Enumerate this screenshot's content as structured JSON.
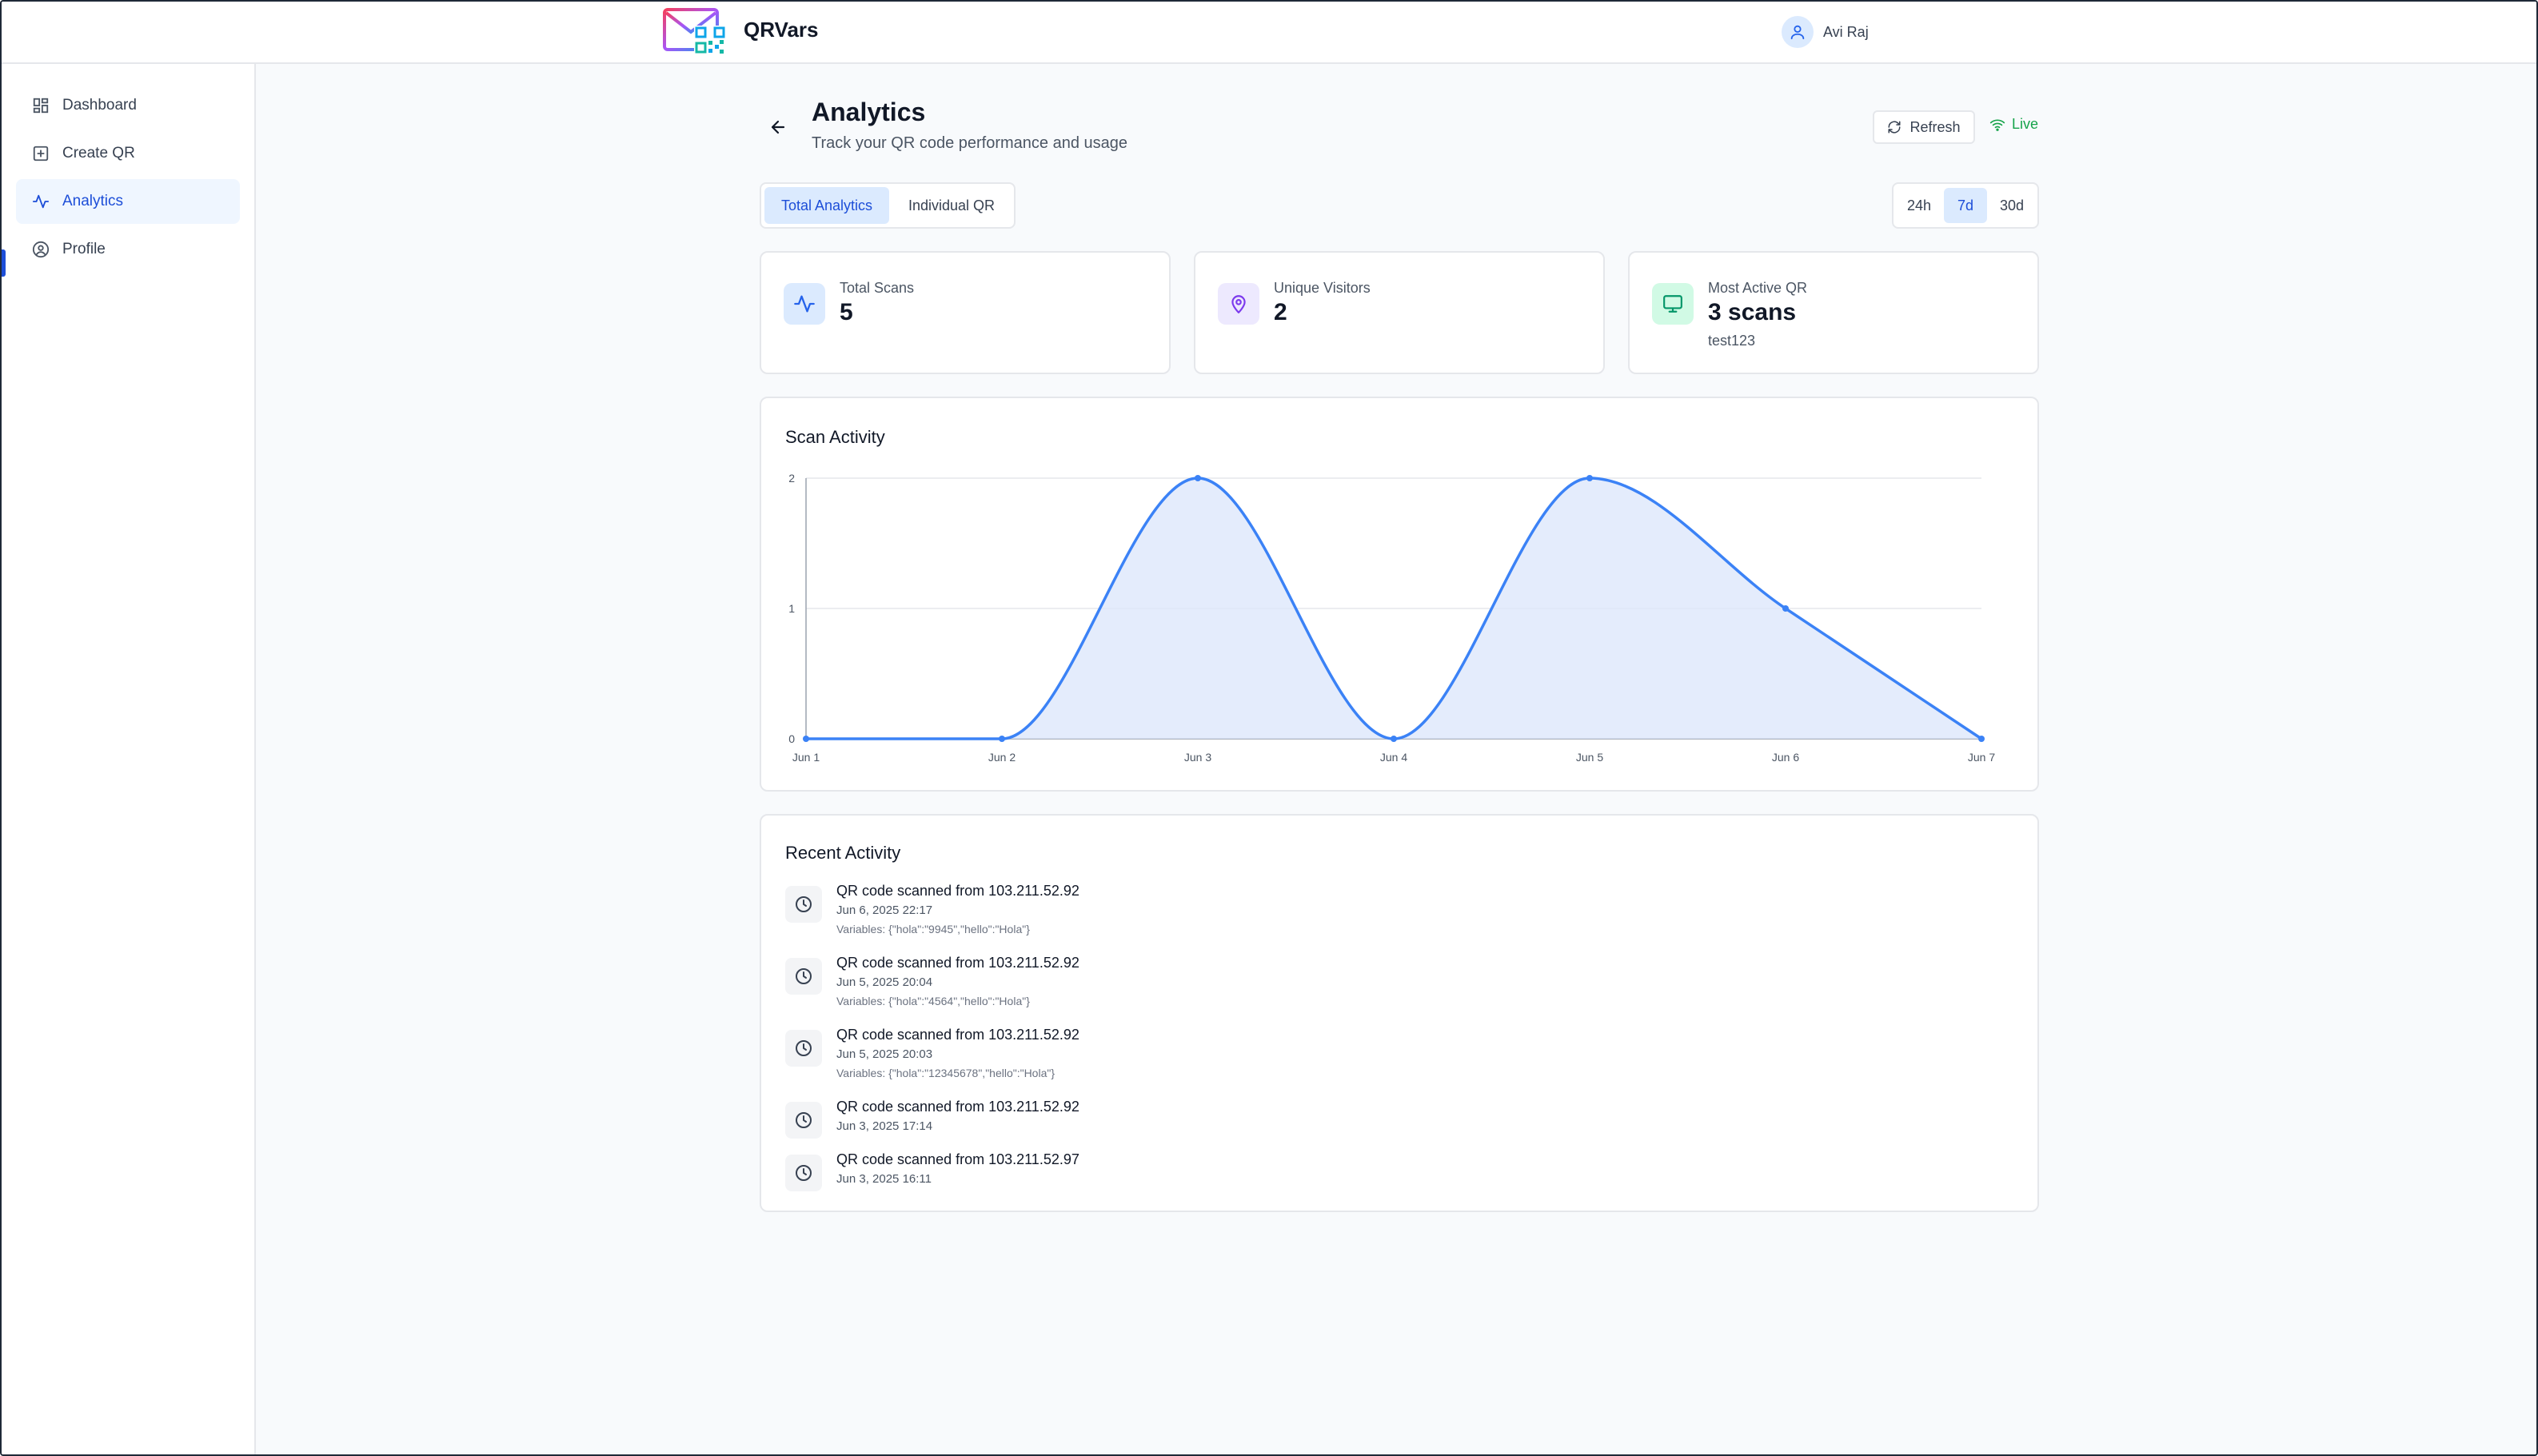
{
  "header": {
    "brand": "QRVars",
    "user_name": "Avi Raj"
  },
  "sidebar": {
    "items": [
      {
        "label": "Dashboard",
        "icon": "grid-icon",
        "active": false
      },
      {
        "label": "Create QR",
        "icon": "plus-square-icon",
        "active": false
      },
      {
        "label": "Analytics",
        "icon": "activity-icon",
        "active": true
      },
      {
        "label": "Profile",
        "icon": "user-circle-icon",
        "active": false
      }
    ]
  },
  "page": {
    "title": "Analytics",
    "subtitle": "Track your QR code performance and usage",
    "refresh_label": "Refresh",
    "live_label": "Live"
  },
  "tabs": [
    {
      "label": "Total Analytics",
      "active": true
    },
    {
      "label": "Individual QR",
      "active": false
    }
  ],
  "time_range": {
    "options": [
      "24h",
      "7d",
      "30d"
    ],
    "selected": "7d"
  },
  "stats": [
    {
      "label": "Total Scans",
      "value": "5",
      "icon": "activity-icon",
      "color": "#2563eb",
      "bg": "#dbeafe"
    },
    {
      "label": "Unique Visitors",
      "value": "2",
      "icon": "map-pin-icon",
      "color": "#7c3aed",
      "bg": "#ede9fe"
    },
    {
      "label": "Most Active QR",
      "value": "3 scans",
      "sub": "test123",
      "icon": "monitor-icon",
      "color": "#059669",
      "bg": "#d1fae5"
    }
  ],
  "chart_title": "Scan Activity",
  "chart_data": {
    "type": "area",
    "title": "Scan Activity",
    "categories": [
      "Jun 1",
      "Jun 2",
      "Jun 3",
      "Jun 4",
      "Jun 5",
      "Jun 6",
      "Jun 7"
    ],
    "series": [
      {
        "values": [
          0,
          0,
          2,
          0,
          2,
          1,
          0
        ]
      }
    ],
    "ylim": [
      0,
      2
    ],
    "yticks": [
      0,
      1,
      2
    ],
    "grid": true,
    "line_color": "#3b82f6",
    "fill_color": "#dbe6fb"
  },
  "recent_activity": {
    "title": "Recent Activity",
    "items": [
      {
        "text": "QR code scanned from 103.211.52.92",
        "time": "Jun 6, 2025 22:17",
        "vars": "Variables: {\"hola\":\"9945\",\"hello\":\"Hola\"}"
      },
      {
        "text": "QR code scanned from 103.211.52.92",
        "time": "Jun 5, 2025 20:04",
        "vars": "Variables: {\"hola\":\"4564\",\"hello\":\"Hola\"}"
      },
      {
        "text": "QR code scanned from 103.211.52.92",
        "time": "Jun 5, 2025 20:03",
        "vars": "Variables: {\"hola\":\"12345678\",\"hello\":\"Hola\"}"
      },
      {
        "text": "QR code scanned from 103.211.52.92",
        "time": "Jun 3, 2025 17:14",
        "vars": ""
      },
      {
        "text": "QR code scanned from 103.211.52.97",
        "time": "Jun 3, 2025 16:11",
        "vars": ""
      }
    ]
  }
}
